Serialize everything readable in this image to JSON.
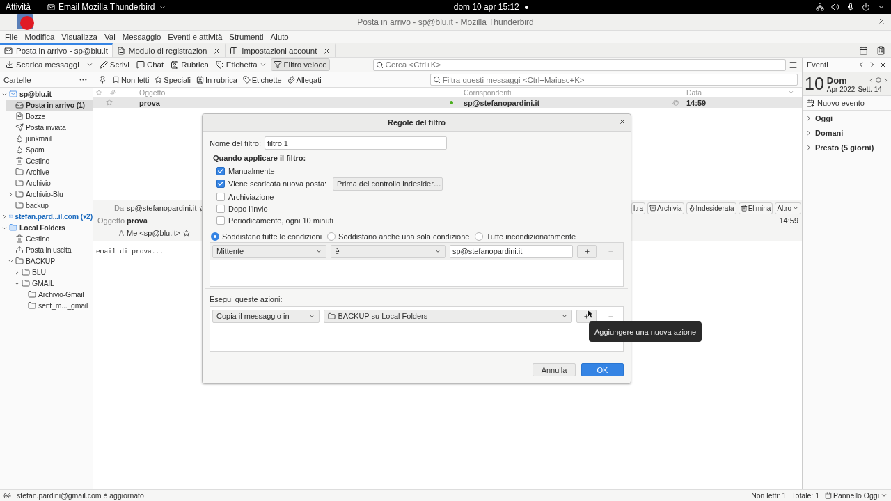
{
  "system_bar": {
    "activities": "Attività",
    "app_menu": "Email Mozilla Thunderbird",
    "clock": "dom 10 apr  15:12"
  },
  "window": {
    "title": "Posta in arrivo - sp@blu.it - Mozilla Thunderbird"
  },
  "menu_bar": [
    "File",
    "Modifica",
    "Visualizza",
    "Vai",
    "Messaggio",
    "Eventi e attività",
    "Strumenti",
    "Aiuto"
  ],
  "tabs": [
    {
      "label": "Posta in arrivo - sp@blu.it",
      "kind": "mail",
      "selected": true,
      "closable": false
    },
    {
      "label": "Modulo di registrazion",
      "kind": "page",
      "selected": false,
      "closable": true
    },
    {
      "label": "Impostazioni account",
      "kind": "settings",
      "selected": false,
      "closable": true
    }
  ],
  "toolbar": {
    "buttons": [
      {
        "label": "Scarica messaggi",
        "kind": "download",
        "dropdown": true,
        "pressed": false
      },
      {
        "label": "Scrivi",
        "kind": "write",
        "dropdown": false,
        "pressed": false
      },
      {
        "label": "Chat",
        "kind": "chat",
        "dropdown": false,
        "pressed": false
      },
      {
        "label": "Rubrica",
        "kind": "contacts",
        "dropdown": false,
        "pressed": false
      },
      {
        "label": "Etichetta",
        "kind": "tag",
        "dropdown": true,
        "pressed": false
      },
      {
        "label": "Filtro veloce",
        "kind": "filter",
        "dropdown": false,
        "pressed": true
      }
    ],
    "search_placeholder": "Cerca <Ctrl+K>"
  },
  "folder_pane": {
    "title": "Cartelle",
    "tree": [
      {
        "label": "sp@blu.it",
        "kind": "account",
        "expanded": true,
        "bold": true,
        "highlighted": false,
        "selected": false,
        "children": [
          {
            "label": "Posta in arrivo (1)",
            "kind": "inbox",
            "bold": true,
            "highlighted": false,
            "selected": true
          },
          {
            "label": "Bozze",
            "kind": "drafts",
            "bold": false,
            "highlighted": false,
            "selected": false
          },
          {
            "label": "Posta inviata",
            "kind": "sent",
            "bold": false,
            "highlighted": false,
            "selected": false
          },
          {
            "label": "junkmail",
            "kind": "junk",
            "bold": false,
            "highlighted": false,
            "selected": false
          },
          {
            "label": "Spam",
            "kind": "junk",
            "bold": false,
            "highlighted": false,
            "selected": false
          },
          {
            "label": "Cestino",
            "kind": "trash",
            "bold": false,
            "highlighted": false,
            "selected": false
          },
          {
            "label": "Archive",
            "kind": "folder",
            "bold": false,
            "highlighted": false,
            "selected": false
          },
          {
            "label": "Archivio",
            "kind": "folder",
            "bold": false,
            "highlighted": false,
            "selected": false
          },
          {
            "label": "Archivio-Blu",
            "kind": "folder",
            "expanded": false,
            "bold": false,
            "highlighted": false,
            "selected": false
          },
          {
            "label": "backup",
            "kind": "folder",
            "bold": false,
            "highlighted": false,
            "selected": false
          }
        ]
      },
      {
        "label": "stefan.pard...il.com (▾2)",
        "kind": "account",
        "expanded": false,
        "bold": true,
        "highlighted": true,
        "selected": false
      },
      {
        "label": "Local Folders",
        "kind": "local",
        "expanded": true,
        "bold": true,
        "highlighted": false,
        "selected": false,
        "children": [
          {
            "label": "Cestino",
            "kind": "trash",
            "bold": false,
            "highlighted": false,
            "selected": false
          },
          {
            "label": "Posta in uscita",
            "kind": "outbox",
            "bold": false,
            "highlighted": false,
            "selected": false
          },
          {
            "label": "BACKUP",
            "kind": "folder",
            "expanded": true,
            "bold": false,
            "highlighted": false,
            "selected": false,
            "children": [
              {
                "label": "BLU",
                "kind": "folder",
                "expanded": false,
                "bold": false,
                "highlighted": false,
                "selected": false
              },
              {
                "label": "GMAIL",
                "kind": "folder",
                "expanded": true,
                "bold": false,
                "highlighted": false,
                "selected": false,
                "children": [
                  {
                    "label": "Archivio-Gmail",
                    "kind": "folder",
                    "bold": false,
                    "highlighted": false,
                    "selected": false
                  },
                  {
                    "label": "sent_m..._gmail",
                    "kind": "folder",
                    "bold": false,
                    "highlighted": false,
                    "selected": false
                  }
                ]
              }
            ]
          }
        ]
      }
    ]
  },
  "quick_filter": {
    "buttons": [
      {
        "label": "Non letti",
        "kind": "unread"
      },
      {
        "label": "Speciali",
        "kind": "starred"
      },
      {
        "label": "In rubrica",
        "kind": "contact"
      },
      {
        "label": "Etichette",
        "kind": "tags"
      },
      {
        "label": "Allegati",
        "kind": "attachment"
      }
    ],
    "filter_placeholder": "Filtra questi messaggi <Ctrl+Maiusc+K>"
  },
  "thread_pane": {
    "columns": [
      "Oggetto",
      "Corrispondenti",
      "Data"
    ],
    "rows": [
      {
        "subject": "prova",
        "correspondent": "sp@stefanopardini.it",
        "date": "14:59",
        "unread": true,
        "starred": false,
        "selected": true
      }
    ]
  },
  "message": {
    "from_label": "Da",
    "from": "sp@stefanopardini.it",
    "subject_label": "Oggetto",
    "subject": "prova",
    "to_label": "A",
    "to": "Me <sp@blu.it>",
    "date": "14:59",
    "actions": [
      {
        "label": "ltra",
        "kind": "forward"
      },
      {
        "label": "Archivia",
        "kind": "archive"
      },
      {
        "label": "Indesiderata",
        "kind": "junk"
      },
      {
        "label": "Elimina",
        "kind": "delete"
      },
      {
        "label": "Altro",
        "kind": "more"
      }
    ],
    "body": "email di prova..."
  },
  "today_pane": {
    "title": "Eventi",
    "day": "10",
    "weekday": "Dom",
    "month": "Apr 2022",
    "week": "Sett. 14",
    "new_event": "Nuovo evento",
    "sections": [
      {
        "label": "Oggi",
        "expanded": false
      },
      {
        "label": "Domani",
        "expanded": false
      },
      {
        "label": "Presto (5 giorni)",
        "expanded": false
      }
    ]
  },
  "status_bar": {
    "message": "stefan.pardini@gmail.com è aggiornato",
    "unread": "Non letti: 1",
    "total": "Totale: 1",
    "today_pane": "Pannello Oggi"
  },
  "dialog": {
    "title": "Regole del filtro",
    "name_label": "Nome del filtro:",
    "name_value": "filtro 1",
    "when_label": "Quando applicare il filtro:",
    "triggers": [
      {
        "label": "Manualmente",
        "checked": true
      },
      {
        "label": "Viene scaricata nuova posta:",
        "checked": true,
        "option": "Prima del controllo indesider…"
      },
      {
        "label": "Archiviazione",
        "checked": false
      },
      {
        "label": "Dopo l'invio",
        "checked": false
      },
      {
        "label": "Periodicamente, ogni 10 minuti",
        "checked": false
      }
    ],
    "match": [
      {
        "label": "Soddisfano tutte le condizioni",
        "selected": true
      },
      {
        "label": "Soddisfano anche una sola condizione",
        "selected": false
      },
      {
        "label": "Tutte incondizionatamente",
        "selected": false
      }
    ],
    "conditions": [
      {
        "field": "Mittente",
        "operator": "è",
        "value": "sp@stefanopardini.it",
        "remove_enabled": false
      }
    ],
    "actions_label": "Esegui queste azioni:",
    "actions": [
      {
        "action": "Copia il messaggio in",
        "target": "BACKUP su Local Folders",
        "remove_enabled": false
      }
    ],
    "tooltip": "Aggiungere una nuova azione",
    "cancel": "Annulla",
    "ok": "OK"
  }
}
